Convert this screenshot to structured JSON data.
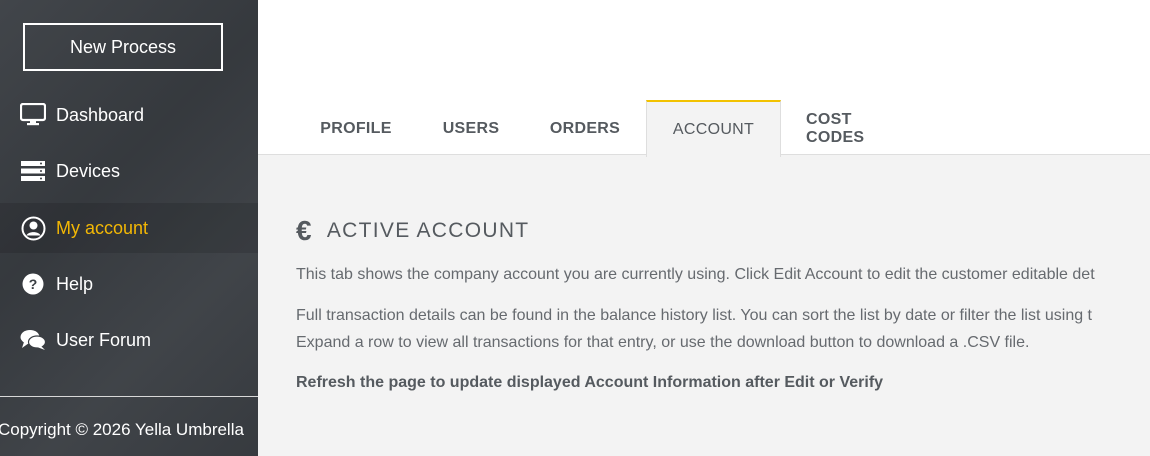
{
  "sidebar": {
    "new_process_label": "New Process",
    "items": [
      {
        "label": "Dashboard",
        "icon": "monitor-icon"
      },
      {
        "label": "Devices",
        "icon": "server-icon"
      },
      {
        "label": "My account",
        "icon": "user-circle-icon",
        "active": true
      },
      {
        "label": "Help",
        "icon": "question-circle-icon"
      },
      {
        "label": "User Forum",
        "icon": "chat-bubbles-icon"
      }
    ],
    "copyright": "Copyright © 2026 Yella Umbrella"
  },
  "tabs": [
    {
      "label": "PROFILE"
    },
    {
      "label": "USERS"
    },
    {
      "label": "ORDERS"
    },
    {
      "label": "ACCOUNT",
      "active": true
    },
    {
      "label": "COST CODES"
    }
  ],
  "content": {
    "title_icon": "€",
    "title": "ACTIVE ACCOUNT",
    "para1": "This tab shows the company account you are currently using.  Click Edit Account to edit the customer editable det",
    "para2_line1": "Full transaction details can be found in the balance history list. You can sort the list by date or filter the list using t",
    "para2_line2": "Expand a row to view all transactions for that entry, or use the download button to download a .CSV file.",
    "para3": "Refresh the page to update displayed Account Information after Edit or Verify"
  },
  "colors": {
    "accent": "#f2b705",
    "sidebar_bg": "#3a3e43",
    "tab_active_border": "#f2c200"
  }
}
